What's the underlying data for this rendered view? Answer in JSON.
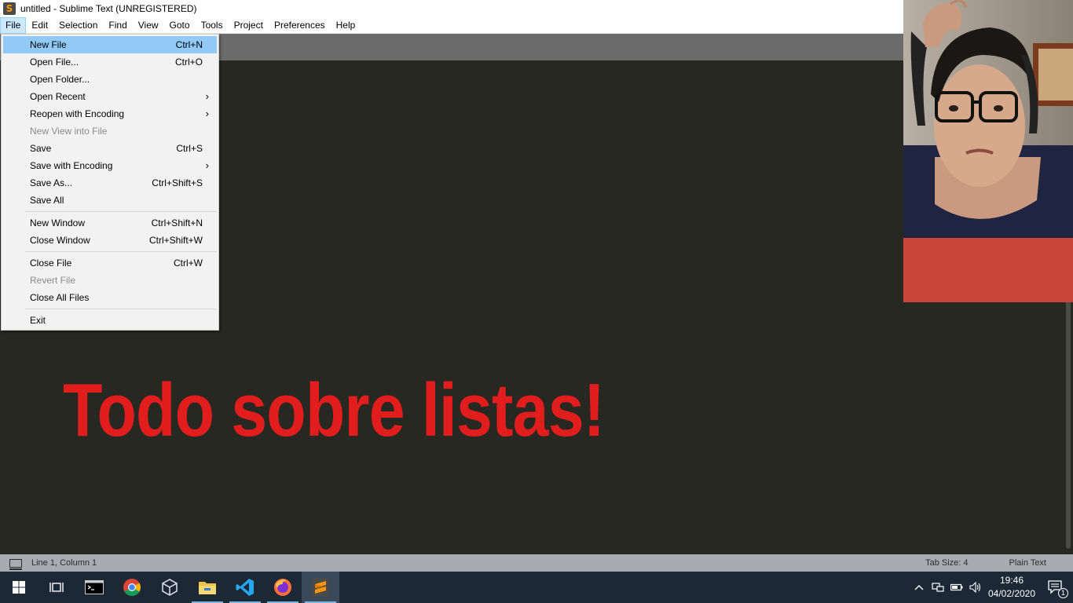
{
  "window": {
    "title": "untitled - Sublime Text (UNREGISTERED)",
    "app_icon_letter": "S"
  },
  "menubar": {
    "items": [
      "File",
      "Edit",
      "Selection",
      "Find",
      "View",
      "Goto",
      "Tools",
      "Project",
      "Preferences",
      "Help"
    ],
    "active": "File"
  },
  "file_menu": {
    "new_file": {
      "label": "New File",
      "shortcut": "Ctrl+N"
    },
    "open_file": {
      "label": "Open File...",
      "shortcut": "Ctrl+O"
    },
    "open_folder": {
      "label": "Open Folder..."
    },
    "open_recent": {
      "label": "Open Recent"
    },
    "reopen_with_encoding": {
      "label": "Reopen with Encoding"
    },
    "new_view_into_file": {
      "label": "New View into File"
    },
    "save": {
      "label": "Save",
      "shortcut": "Ctrl+S"
    },
    "save_with_encoding": {
      "label": "Save with Encoding"
    },
    "save_as": {
      "label": "Save As...",
      "shortcut": "Ctrl+Shift+S"
    },
    "save_all": {
      "label": "Save All"
    },
    "new_window": {
      "label": "New Window",
      "shortcut": "Ctrl+Shift+N"
    },
    "close_window": {
      "label": "Close Window",
      "shortcut": "Ctrl+Shift+W"
    },
    "close_file": {
      "label": "Close File",
      "shortcut": "Ctrl+W"
    },
    "revert_file": {
      "label": "Revert File"
    },
    "close_all_files": {
      "label": "Close All Files"
    },
    "exit": {
      "label": "Exit"
    },
    "submenu_arrow": "›"
  },
  "overlay": {
    "title": "Todo sobre listas!",
    "color": "#e21d1d"
  },
  "statusbar": {
    "position": "Line 1, Column 1",
    "tab_size": "Tab Size: 4",
    "syntax": "Plain Text"
  },
  "taskbar": {
    "apps": [
      "windows-start",
      "task-view",
      "terminal",
      "chrome",
      "virtualbox",
      "file-explorer",
      "vscode",
      "firefox",
      "sublime-text"
    ],
    "time": "19:46",
    "date": "04/02/2020",
    "notification_count": "1"
  },
  "colors": {
    "editor_bg": "#272822",
    "tabbar_bg": "#6b6b6b",
    "statusbar_bg": "#a8acb0",
    "taskbar_bg": "#1c2836",
    "menu_highlight": "#91c9f7"
  }
}
